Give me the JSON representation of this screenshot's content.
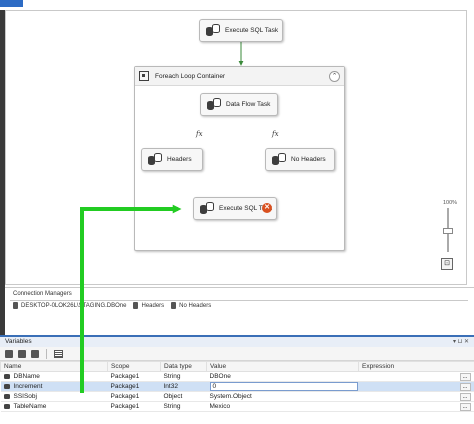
{
  "canvas": {
    "tasks": {
      "execute_sql_top": "Execute SQL Task",
      "data_flow": "Data Flow Task",
      "headers": "Headers",
      "no_headers": "No Headers",
      "execute_sql_bottom": "Execute SQL Task"
    },
    "container_label": "Foreach Loop Container",
    "collapse_symbol": "⌃",
    "fx_left": "fx",
    "fx_right": "fx",
    "zoom_level": "100%",
    "error_symbol": "✕"
  },
  "connection_managers": {
    "title": "Connection Managers",
    "items": [
      "DESKTOP-0LOK26L\\STAGING.DBOne",
      "Headers",
      "No Headers"
    ]
  },
  "variables": {
    "title": "Variables",
    "title_controls": "▾ ⊔ ✕",
    "columns": [
      "Name",
      "Scope",
      "Data type",
      "Value",
      "Expression"
    ],
    "rows": [
      {
        "name": "DBName",
        "scope": "Package1",
        "type": "String",
        "value": "DBOne"
      },
      {
        "name": "Increment",
        "scope": "Package1",
        "type": "Int32",
        "value": "0"
      },
      {
        "name": "SSISobj",
        "scope": "Package1",
        "type": "Object",
        "value": "System.Object"
      },
      {
        "name": "TableName",
        "scope": "Package1",
        "type": "String",
        "value": "Mexico"
      }
    ],
    "ellipsis": "..."
  },
  "colors": {
    "highlight_arrow": "#22cc22",
    "success_arrow": "#3a8a3a",
    "selected_row": "#cfe0f5",
    "error_icon": "#d9501f"
  }
}
